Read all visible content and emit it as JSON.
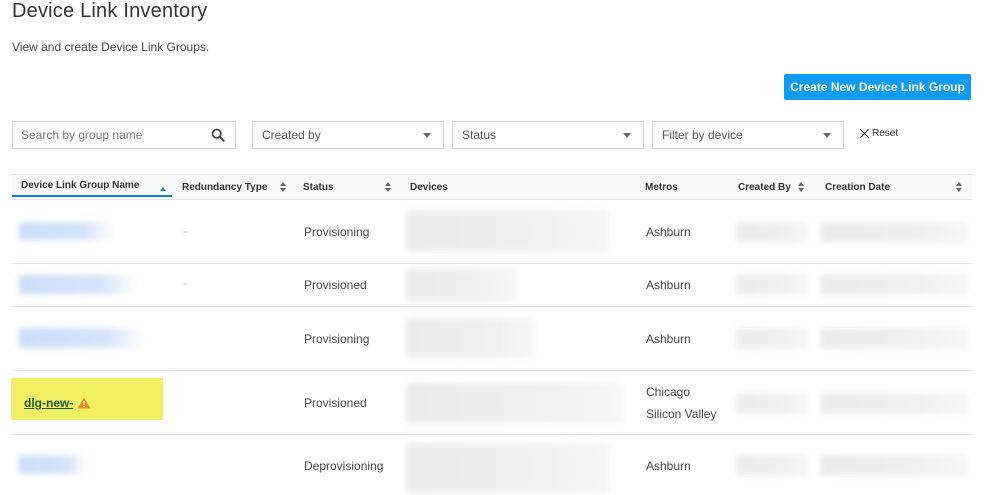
{
  "page": {
    "title": "Device Link Inventory",
    "subtitle": "View and create Device Link Groups.",
    "create_button": "Create New Device Link Group"
  },
  "filters": {
    "search_placeholder": "Search by group name",
    "created_by": "Created by",
    "status": "Status",
    "device": "Filter by device",
    "reset": "Reset"
  },
  "table": {
    "columns": [
      "Device Link Group Name",
      "Redundancy Type",
      "Status",
      "Devices",
      "Metros",
      "Created By",
      "Creation Date"
    ],
    "rows": [
      {
        "name": "",
        "redundancy": "-",
        "status": "Provisioning",
        "metros": [
          "Ashburn"
        ]
      },
      {
        "name": "",
        "redundancy": "-",
        "status": "Provisioned",
        "metros": [
          "Ashburn"
        ]
      },
      {
        "name": "",
        "redundancy": "",
        "status": "Provisioning",
        "metros": [
          "Ashburn"
        ]
      },
      {
        "name": "dlg-new-",
        "redundancy": "",
        "status": "Provisioned",
        "metros": [
          "Chicago",
          "Silicon Valley"
        ]
      },
      {
        "name": "",
        "redundancy": "",
        "status": "Deprovisioning",
        "metros": [
          "Ashburn"
        ]
      }
    ]
  },
  "colors": {
    "accent": "#0d9cf2",
    "highlight": "#f0ef64",
    "link": "#1f5e2a",
    "warning": "#e8891c"
  }
}
